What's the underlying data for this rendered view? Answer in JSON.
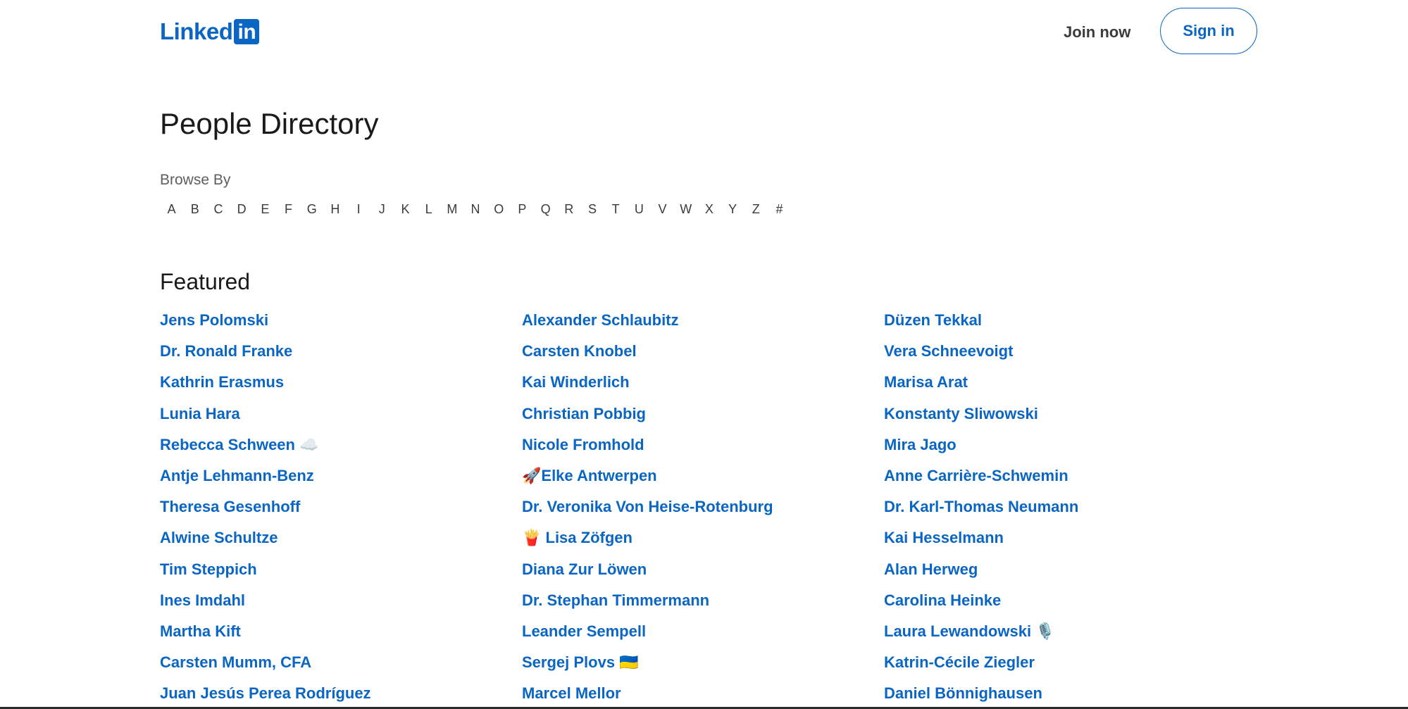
{
  "header": {
    "logo_text": "Linked",
    "logo_box": "in",
    "join_now": "Join now",
    "sign_in": "Sign in"
  },
  "page": {
    "title": "People Directory",
    "browse_by": "Browse By",
    "letters": [
      "A",
      "B",
      "C",
      "D",
      "E",
      "F",
      "G",
      "H",
      "I",
      "J",
      "K",
      "L",
      "M",
      "N",
      "O",
      "P",
      "Q",
      "R",
      "S",
      "T",
      "U",
      "V",
      "W",
      "X",
      "Y",
      "Z",
      "#"
    ]
  },
  "featured": {
    "title": "Featured",
    "columns": [
      [
        "Jens Polomski",
        "Dr. Ronald Franke",
        "Kathrin Erasmus",
        "Lunia Hara",
        "Rebecca Schween ☁️",
        "Antje Lehmann-Benz",
        "Theresa Gesenhoff",
        "Alwine Schultze",
        "Tim Steppich",
        "Ines Imdahl",
        "Martha Kift",
        "Carsten Mumm, CFA",
        "Juan Jesús Perea Rodríguez"
      ],
      [
        "Alexander Schlaubitz",
        "Carsten Knobel",
        "Kai Winderlich",
        "Christian Pobbig",
        "Nicole Fromhold",
        "🚀Elke Antwerpen",
        "Dr. Veronika Von Heise-Rotenburg",
        "🍟 Lisa Zöfgen",
        "Diana Zur Löwen",
        "Dr. Stephan Timmermann",
        "Leander Sempell",
        "Sergej Plovs 🇺🇦",
        "Marcel Mellor"
      ],
      [
        "Düzen Tekkal",
        "Vera Schneevoigt",
        "Marisa Arat",
        "Konstanty Sliwowski",
        "Mira Jago",
        "Anne Carrière-Schwemin",
        "Dr. Karl-Thomas Neumann",
        "Kai Hesselmann",
        "Alan Herweg",
        "Carolina Heinke",
        "Laura Lewandowski 🎙️",
        "Katrin-Cécile Ziegler",
        "Daniel Bönnighausen"
      ]
    ]
  }
}
